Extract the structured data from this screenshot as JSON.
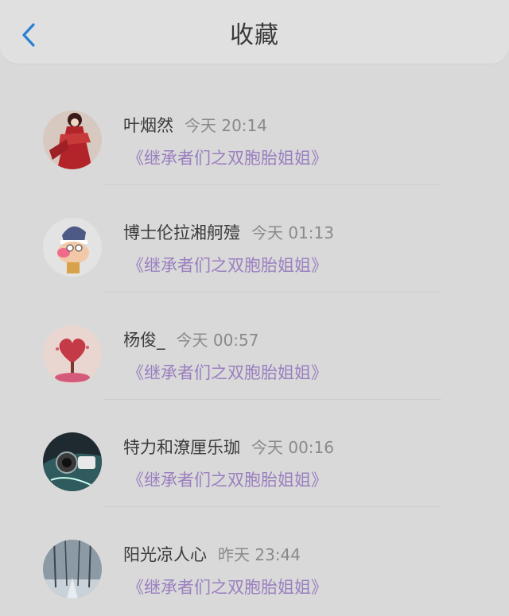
{
  "header": {
    "title": "收藏",
    "back_icon": "chevron-left-icon",
    "accent": "#1e88e5"
  },
  "favorites": [
    {
      "name": "叶烟然",
      "time": "今天 20:14",
      "source": "《继承者们之双胞胎姐姐》",
      "avatar": "anime-girl-red-avatar"
    },
    {
      "name": "博士伦拉湘舸殪",
      "time": "今天 01:13",
      "source": "《继承者们之双胞胎姐姐》",
      "avatar": "cartoon-detective-avatar"
    },
    {
      "name": "杨俊_",
      "time": "今天 00:57",
      "source": "《继承者们之双胞胎姐姐》",
      "avatar": "heart-tree-avatar"
    },
    {
      "name": "特力和潦厘乐珈",
      "time": "今天 00:16",
      "source": "《继承者们之双胞胎姐姐》",
      "avatar": "camera-photo-avatar"
    },
    {
      "name": "阳光凉人心",
      "time": "昨天 23:44",
      "source": "《继承者们之双胞胎姐姐》",
      "avatar": "snowy-forest-avatar"
    }
  ]
}
